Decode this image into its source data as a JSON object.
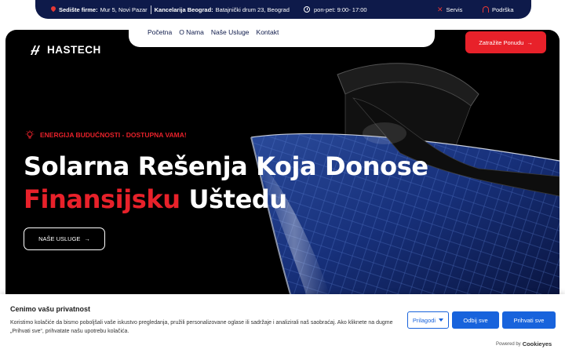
{
  "topbar": {
    "hq_label": "Sedište firme:",
    "hq_address": "Mur 5, Novi Pazar",
    "office_label": "Kancelarija Beograd:",
    "office_address": "Batajnički drum 23, Beograd",
    "hours": "pon-pet: 9:00- 17:00",
    "service_link": "Servis",
    "support_link": "Podrška"
  },
  "nav": {
    "items": [
      {
        "label": "Početna"
      },
      {
        "label": "O Nama"
      },
      {
        "label": "Naše Usluge"
      },
      {
        "label": "Kontakt"
      }
    ]
  },
  "logo": {
    "text": "HASTECH"
  },
  "header": {
    "cta_label": "Zatražite Ponudu"
  },
  "hero": {
    "eyebrow": "ENERGIJA BUDUĆNOSTI - DOSTUPNA VAMA!",
    "title_line1": "Solarna Rešenja Koja Donose",
    "title_highlight": "Finansijsku",
    "title_rest": "Uštedu",
    "button_label": "NAŠE USLUGE"
  },
  "cookie": {
    "title": "Cenimo vašu privatnost",
    "description": "Koristimo kolačiće da bismo poboljšali vaše iskustvo pregledanja, pružili personalizovane oglase ili sadržaje i analizirali naš saobraćaj. Ako kliknete na dugme „Prihvati sve“, prihvatate našu upotrebu kolačića.",
    "customize_label": "Prilagodi",
    "reject_label": "Odbij sve",
    "accept_label": "Prihvati sve",
    "powered_by": "Powered by",
    "powered_brand": "Cookieyes"
  },
  "colors": {
    "accent_red": "#e8212a",
    "navy": "#0e1a4a",
    "cookie_blue": "#1863dc"
  }
}
